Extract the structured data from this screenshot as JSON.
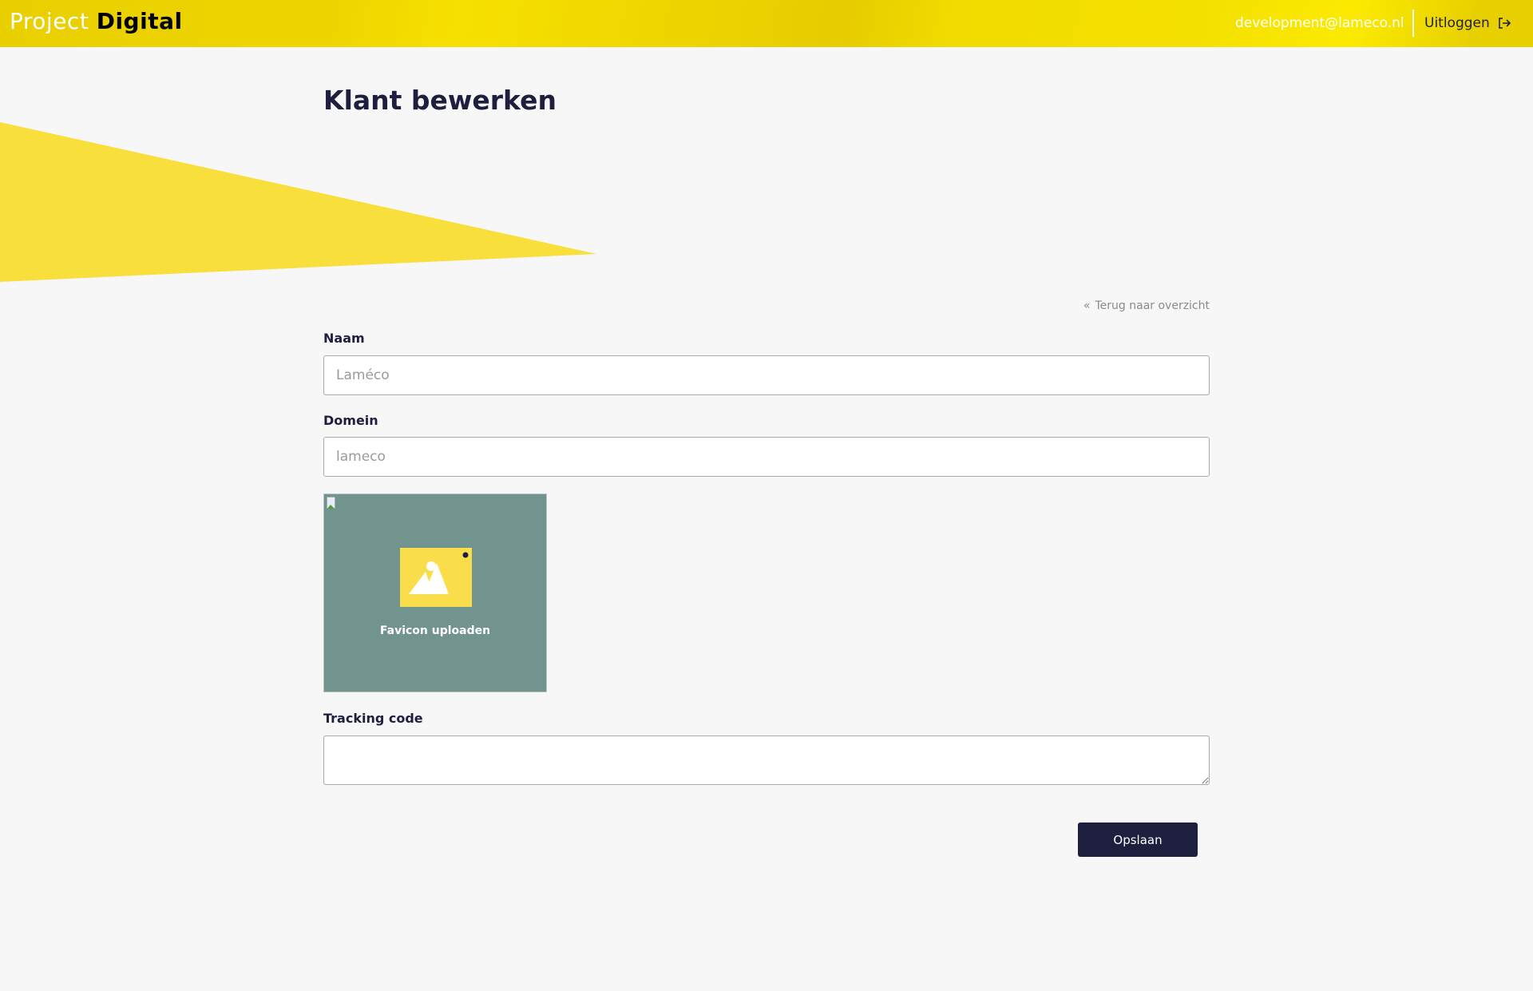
{
  "header": {
    "logo_light": "Project",
    "logo_bold": "Digital",
    "user_email": "development@lameco.nl",
    "logout_label": "Uitloggen"
  },
  "page": {
    "title": "Klant bewerken",
    "back_link": "Terug naar overzicht"
  },
  "form": {
    "name": {
      "label": "Naam",
      "placeholder": "Laméco"
    },
    "domain": {
      "label": "Domein",
      "placeholder": "lameco"
    },
    "favicon": {
      "label": "Favicon uploaden"
    },
    "tracking": {
      "label": "Tracking code",
      "value": ""
    },
    "save_label": "Opslaan"
  },
  "colors": {
    "brand_yellow": "#f5de00",
    "navy": "#1e1e3f",
    "upload_bg": "#71948f"
  }
}
